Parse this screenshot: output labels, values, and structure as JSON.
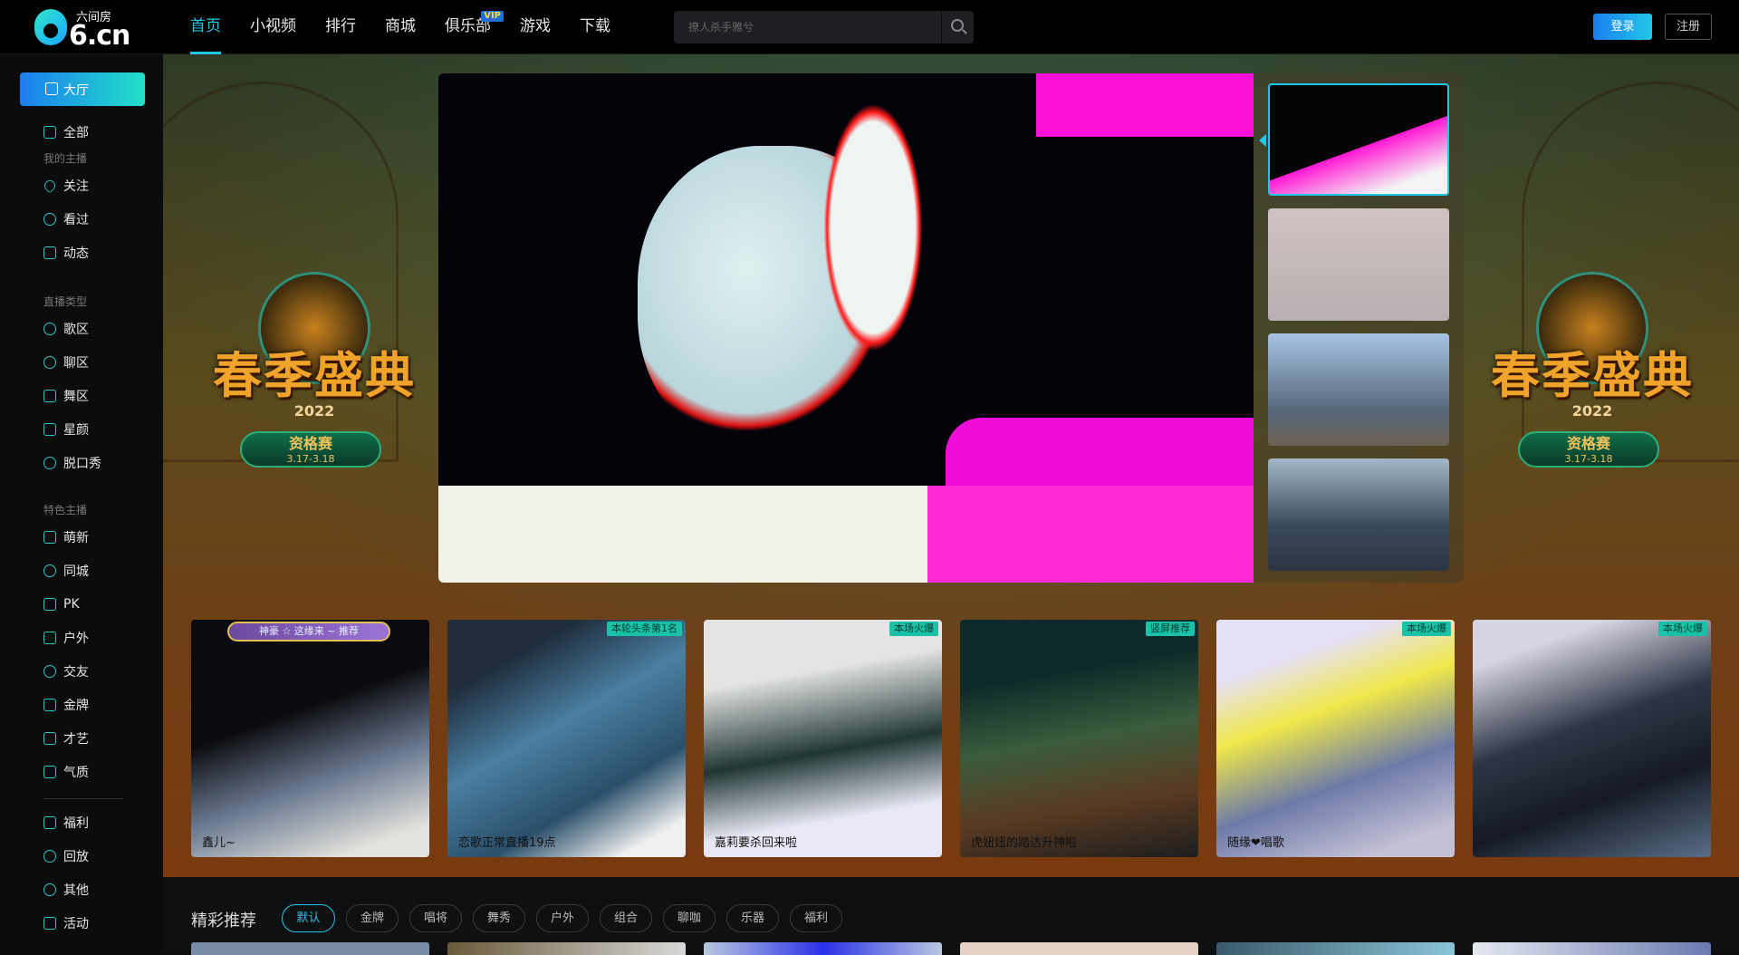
{
  "logo": {
    "text": "6.cn",
    "subtitle": "六间房"
  },
  "nav": [
    {
      "label": "首页"
    },
    {
      "label": "小视频"
    },
    {
      "label": "排行"
    },
    {
      "label": "商城"
    },
    {
      "label": "俱乐部",
      "badge": "VIP"
    },
    {
      "label": "游戏"
    },
    {
      "label": "下载"
    }
  ],
  "search": {
    "placeholder": "撩人杀手雅兮"
  },
  "auth": {
    "login": "登录",
    "register": "注册"
  },
  "sidebar": {
    "active": "大厅",
    "items_top": [
      "全部"
    ],
    "cat_my": "我的主播",
    "items_my": [
      "关注",
      "看过",
      "动态"
    ],
    "cat_type": "直播类型",
    "items_type": [
      "歌区",
      "聊区",
      "舞区",
      "星颜",
      "脱口秀"
    ],
    "cat_feature": "特色主播",
    "items_feature": [
      "萌新",
      "同城",
      "PK",
      "户外",
      "交友",
      "金牌",
      "才艺",
      "气质"
    ],
    "items_bottom": [
      "福利",
      "回放",
      "其他",
      "活动"
    ]
  },
  "banner": {
    "title": "春季盛典",
    "year": "2022",
    "stage": "资格赛",
    "dates": "3.17-3.18"
  },
  "hot_cards": [
    {
      "name": "鑫儿~",
      "tag": "",
      "banner": "神豪 ☆ 这缘来 ~ 推荐"
    },
    {
      "name": "恋歌正常直播19点",
      "tag": "本轮头条第1名"
    },
    {
      "name": "嘉莉要杀回来啦",
      "tag": "本场火爆"
    },
    {
      "name": "虎妞妞的踏达升神啦",
      "tag": "竖屏推荐"
    },
    {
      "name": "随缘❤唱歌",
      "tag": "本场火爆"
    },
    {
      "name": "",
      "tag": "本场火爆"
    }
  ],
  "recommend": {
    "title": "精彩推荐",
    "chips": [
      "默认",
      "金牌",
      "唱将",
      "舞秀",
      "户外",
      "组合",
      "聊咖",
      "乐器",
      "福利"
    ],
    "active": "默认"
  },
  "colors": {
    "accent": "#22c7e8",
    "brand_gradient": [
      "#1c7ef0",
      "#22e0c8"
    ],
    "tag": "#19c2a6"
  }
}
